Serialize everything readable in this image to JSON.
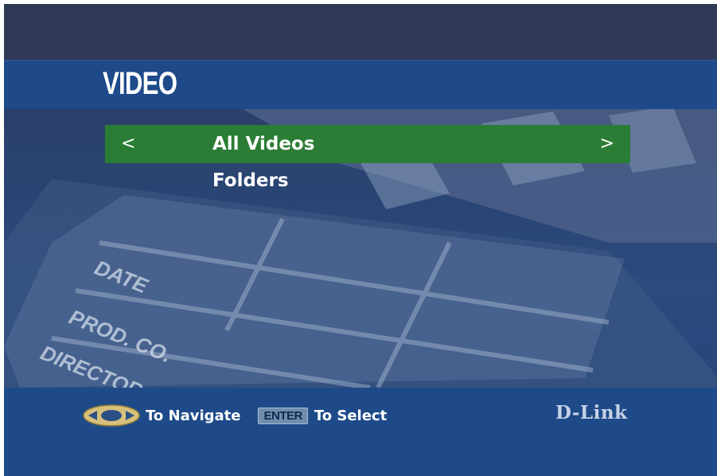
{
  "header": {
    "title": "VIDEO"
  },
  "menu": {
    "items": [
      {
        "label": "All Videos",
        "selected": true,
        "prev_glyph": "<",
        "next_glyph": ">"
      },
      {
        "label": "Folders",
        "selected": false
      }
    ]
  },
  "footer": {
    "navigate_label": "To Navigate",
    "enter_key_label": "ENTER",
    "select_label": "To Select",
    "brand": "D-Link"
  },
  "background_art": {
    "labels": [
      "DATE",
      "PROD. CO.",
      "DIRECTOR"
    ]
  },
  "colors": {
    "band": "#1e4a8a",
    "selected": "#2b7d35",
    "background": "#2b4a7e"
  }
}
